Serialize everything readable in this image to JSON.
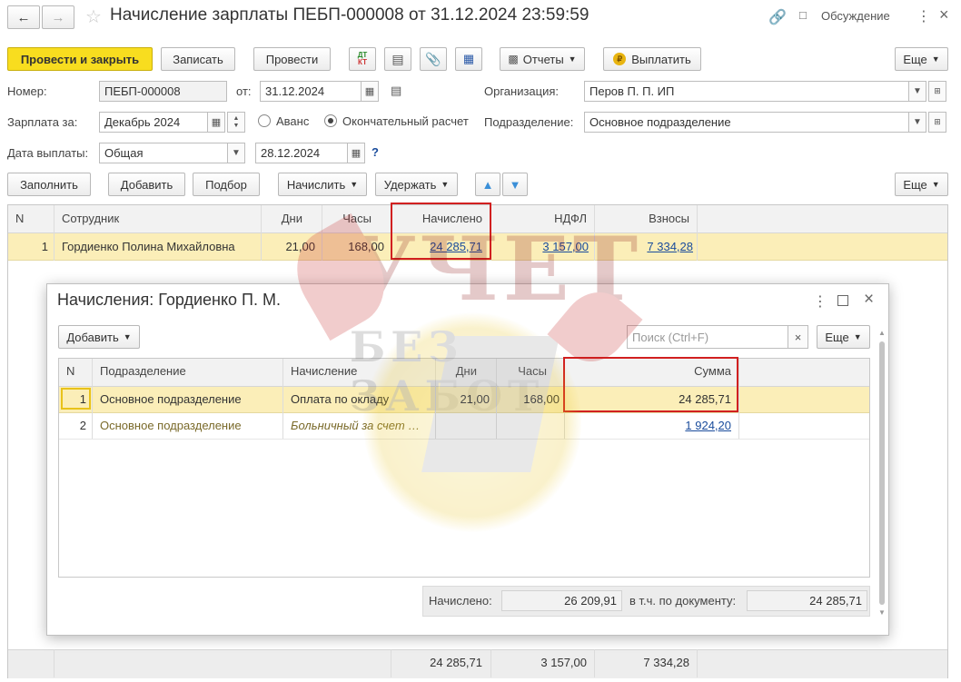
{
  "window": {
    "title": "Начисление зарплаты ПЕБП-000008 от 31.12.2024 23:59:59",
    "discussion_label": "Обсуждение"
  },
  "toolbar": {
    "post_close": "Провести и закрыть",
    "save": "Записать",
    "post": "Провести",
    "dt_kt": "Дт Кт",
    "reports": "Отчеты",
    "pay": "Выплатить",
    "more": "Еще"
  },
  "form": {
    "number_label": "Номер:",
    "number_value": "ПЕБП-000008",
    "date_label": "от:",
    "date_value": "31.12.2024",
    "org_label": "Организация:",
    "org_value": "Перов П. П. ИП",
    "salary_for_label": "Зарплата за:",
    "salary_for_value": "Декабрь 2024",
    "radio_advance": "Аванс",
    "radio_final": "Окончательный расчет",
    "dept_label": "Подразделение:",
    "dept_value": "Основное подразделение",
    "pay_date_label": "Дата выплаты:",
    "pay_type_value": "Общая",
    "pay_date_value": "28.12.2024",
    "help": "?"
  },
  "table_toolbar": {
    "fill": "Заполнить",
    "add": "Добавить",
    "pick": "Подбор",
    "accrue": "Начислить",
    "withhold": "Удержать",
    "more": "Еще"
  },
  "main_table": {
    "headers": [
      "N",
      "Сотрудник",
      "Дни",
      "Часы",
      "Начислено",
      "НДФЛ",
      "Взносы"
    ],
    "rows": [
      {
        "n": "1",
        "employee": "Гордиенко Полина Михайловна",
        "days": "21,00",
        "hours": "168,00",
        "accrued": "24 285,71",
        "ndfl": "3 157,00",
        "contrib": "7 334,28"
      }
    ],
    "totals": {
      "accrued": "24 285,71",
      "ndfl": "3 157,00",
      "contrib": "7 334,28"
    }
  },
  "dialog": {
    "title": "Начисления: Гордиенко П. М.",
    "add": "Добавить",
    "search_placeholder": "Поиск (Ctrl+F)",
    "more": "Еще",
    "headers": [
      "N",
      "Подразделение",
      "Начисление",
      "Дни",
      "Часы",
      "Сумма"
    ],
    "rows": [
      {
        "n": "1",
        "dept": "Основное подразделение",
        "accrual": "Оплата по окладу",
        "days": "21,00",
        "hours": "168,00",
        "sum": "24 285,71"
      },
      {
        "n": "2",
        "dept": "Основное подразделение",
        "accrual": "Больничный за счет …",
        "days": "",
        "hours": "",
        "sum": "1 924,20"
      }
    ],
    "footer": {
      "accrued_label": "Начислено:",
      "accrued_value": "26 209,91",
      "doc_label": "в т.ч. по документу:",
      "doc_value": "24 285,71"
    }
  },
  "watermark": {
    "line1": "УЧЕТ",
    "line2": "БЕЗ ЗАБОТ"
  },
  "colors": {
    "primary_button": "#f8dd1f",
    "row_highlight": "#fbeeb8",
    "red_frame": "#d12020",
    "link": "#1a4c9c"
  }
}
